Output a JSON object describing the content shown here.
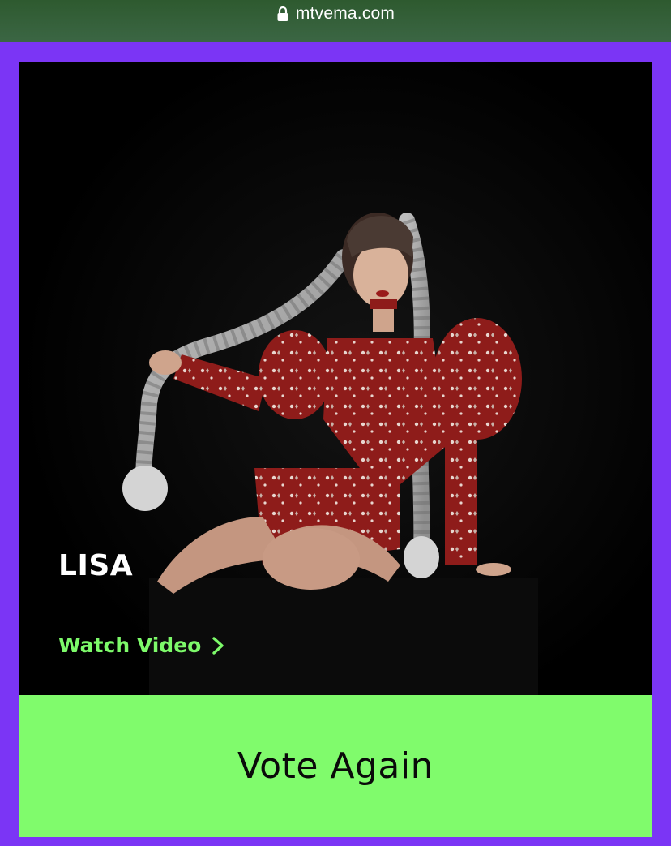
{
  "browser": {
    "url": "mtvema.com",
    "lock_icon": "lock-icon"
  },
  "card": {
    "artist_name": "LISA",
    "watch_video_label": "Watch Video",
    "watch_video_icon": "chevron-right-icon",
    "vote_button_label": "Vote Again"
  },
  "colors": {
    "page_background": "#7b35f5",
    "url_bar": "#355f39",
    "accent_green": "#80fb6c",
    "link_green": "#7dfa6a",
    "card_background": "#000000"
  }
}
